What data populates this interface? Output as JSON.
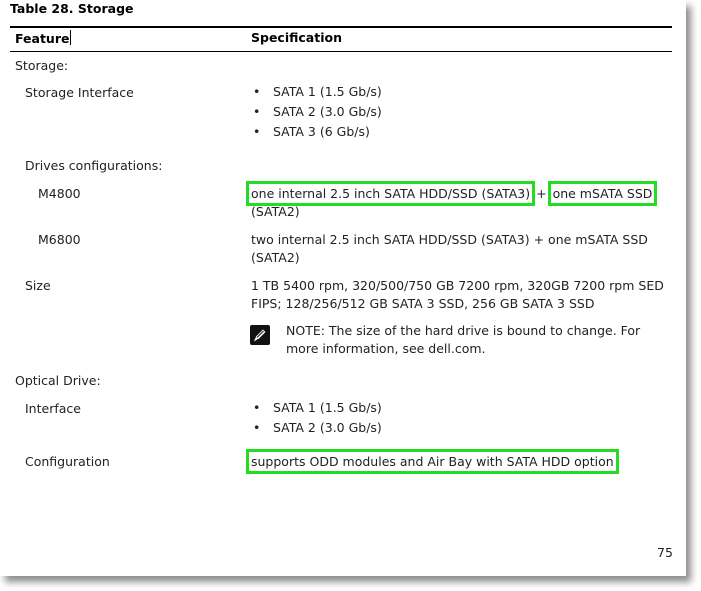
{
  "table": {
    "title": "Table 28. Storage",
    "header": {
      "feature": "Feature",
      "specification": "Specification"
    }
  },
  "storage": {
    "section_label": "Storage:",
    "interface": {
      "label": "Storage Interface",
      "items": [
        "SATA 1 (1.5 Gb/s)",
        "SATA 2 (3.0 Gb/s)",
        "SATA 3 (6 Gb/s)"
      ]
    },
    "drives": {
      "label": "Drives configurations:",
      "m4800": {
        "label": "M4800",
        "part1": "one internal 2.5 inch SATA HDD/SSD (SATA3)",
        "plus": "+",
        "part2": "one mSATA SSD",
        "line2": "(SATA2)"
      },
      "m6800": {
        "label": "M6800",
        "line1": "two internal 2.5 inch SATA HDD/SSD (SATA3) + one mSATA SSD",
        "line2": "(SATA2)"
      }
    },
    "size": {
      "label": "Size",
      "line1": "1 TB 5400 rpm, 320/500/750 GB 7200 rpm, 320GB 7200 rpm SED",
      "line2": "FIPS; 128/256/512 GB SATA 3 SSD, 256 GB SATA 3 SSD"
    },
    "note": {
      "icon": "pencil-note-icon",
      "label": "NOTE:",
      "line1": "The size of the hard drive is bound to change. For",
      "line2": "more information, see dell.com."
    }
  },
  "optical": {
    "section_label": "Optical Drive:",
    "interface": {
      "label": "Interface",
      "items": [
        "SATA 1 (1.5 Gb/s)",
        "SATA 2 (3.0 Gb/s)"
      ]
    },
    "configuration": {
      "label": "Configuration",
      "value": "supports ODD modules and Air Bay with SATA HDD option"
    }
  },
  "page_number": "75",
  "colors": {
    "highlight": "#22dd22",
    "text": "#222222",
    "rule": "#000000"
  }
}
